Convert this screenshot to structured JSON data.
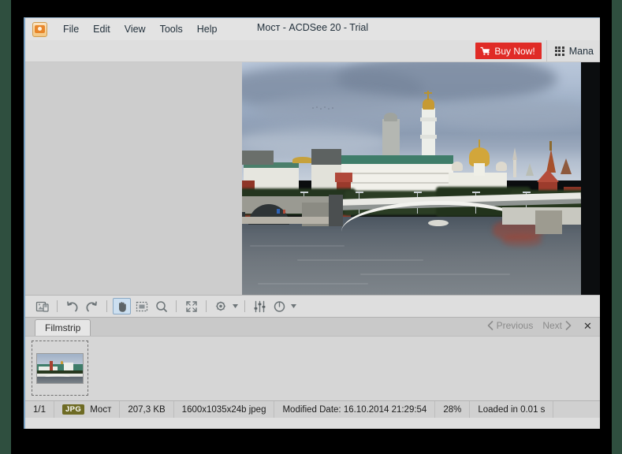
{
  "window": {
    "title": "Мост - ACDSee 20 - Trial"
  },
  "menubar": {
    "logo_icon": "acdsee-camera-icon",
    "items": [
      {
        "label": "File"
      },
      {
        "label": "Edit"
      },
      {
        "label": "View"
      },
      {
        "label": "Tools"
      },
      {
        "label": "Help"
      }
    ]
  },
  "topbar": {
    "buy_now_label": "Buy Now!",
    "buy_now_icon": "shopping-cart-icon",
    "buy_now_color": "#e02b26",
    "manage_label": "Mana",
    "manage_icon": "grid-icon"
  },
  "edit_toolbar": {
    "buttons": [
      {
        "name": "save-image-icon",
        "title": "Save"
      },
      {
        "name": "undo-icon",
        "title": "Undo"
      },
      {
        "name": "redo-icon",
        "title": "Redo"
      },
      {
        "name": "hand-pan-icon",
        "title": "Pan",
        "active": true
      },
      {
        "name": "marquee-select-icon",
        "title": "Select"
      },
      {
        "name": "zoom-magnifier-icon",
        "title": "Zoom"
      },
      {
        "name": "fit-to-window-icon",
        "title": "Fit to window"
      },
      {
        "name": "effects-icon",
        "title": "Effects"
      },
      {
        "name": "adjust-sliders-icon",
        "title": "Adjust"
      },
      {
        "name": "exposure-clock-icon",
        "title": "Exposure"
      }
    ]
  },
  "filmstrip": {
    "tab_label": "Filmstrip",
    "previous_label": "Previous",
    "next_label": "Next",
    "prev_icon": "chevron-left-icon",
    "next_icon": "chevron-right-icon",
    "close_icon": "close-icon",
    "close_label": "✕",
    "thumbnails": [
      {
        "name": "thumbnail-most",
        "selected": true
      }
    ]
  },
  "statusbar": {
    "index": "1/1",
    "format_badge": "JPG",
    "filename": "Мост",
    "filesize": "207,3 KB",
    "dimensions": "1600x1035x24b jpeg",
    "modified": "Modified Date: 16.10.2014 21:29:54",
    "zoom": "28%",
    "load_time": "Loaded in 0.01 s"
  },
  "photo": {
    "alt": "Moscow Kremlin across the Moskva river with Bolshoy Kamenny bridge"
  }
}
